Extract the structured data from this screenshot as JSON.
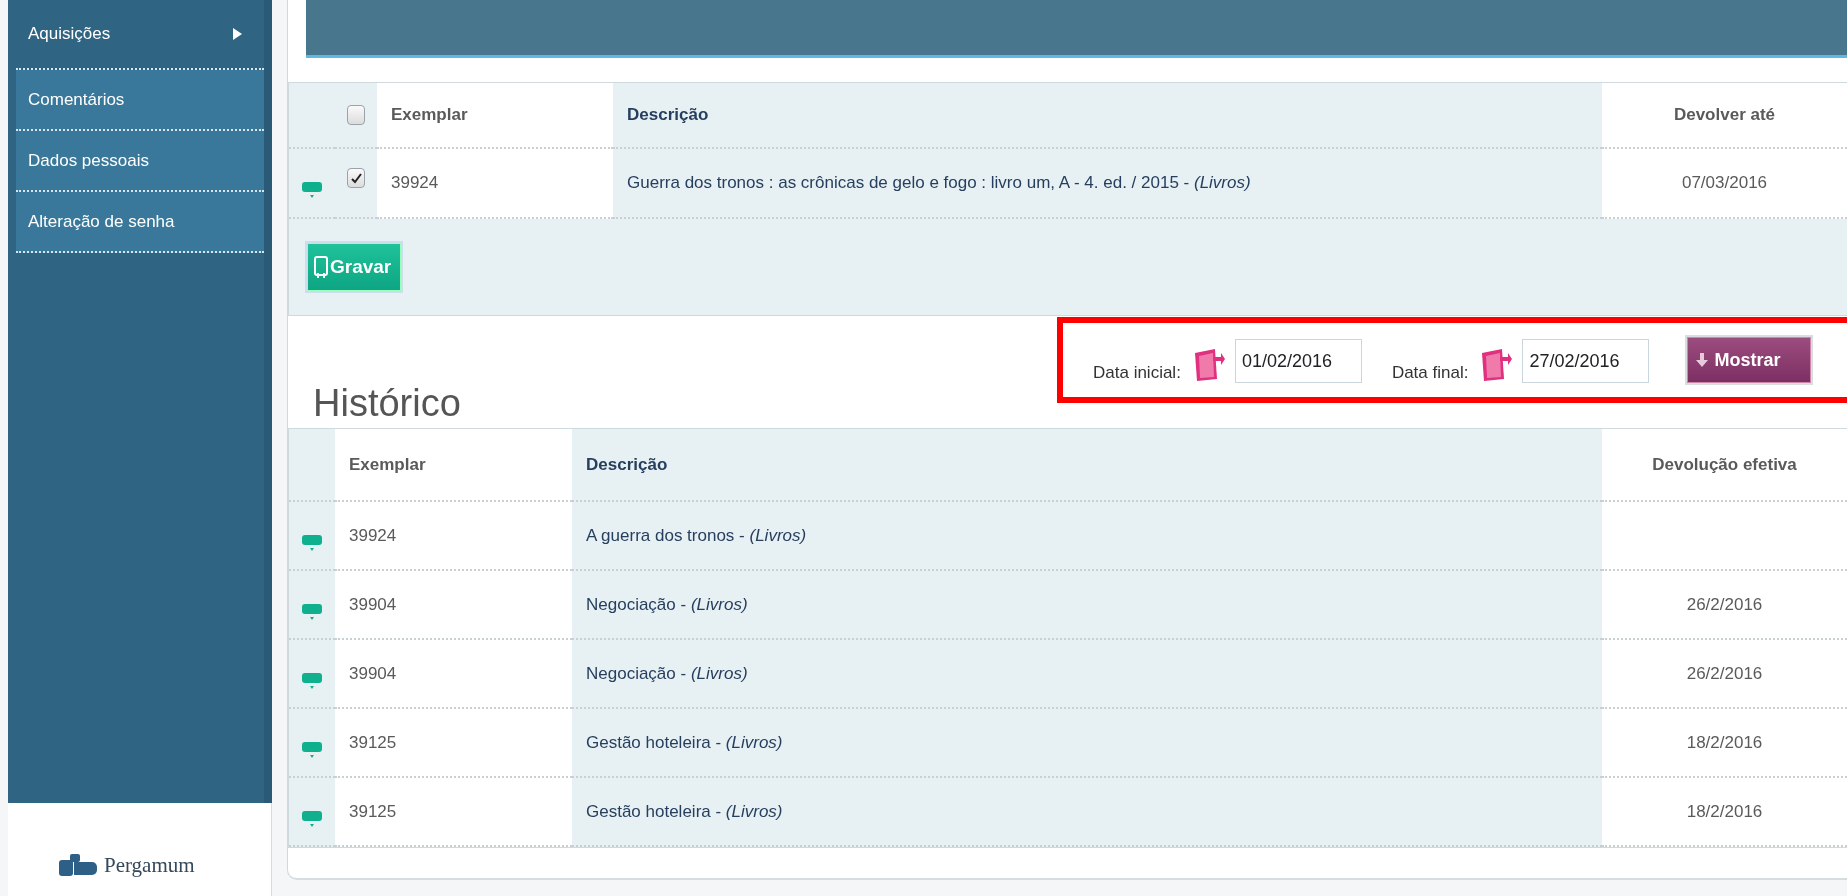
{
  "sidebar": {
    "items": [
      {
        "label": "Aquisições",
        "has_submenu": true,
        "selected": true
      },
      {
        "label": "Comentários",
        "has_submenu": false,
        "selected": false
      },
      {
        "label": "Dados pessoais",
        "has_submenu": false,
        "selected": false
      },
      {
        "label": "Alteração de senha",
        "has_submenu": false,
        "selected": false
      }
    ],
    "logo": "Pergamum"
  },
  "loans": {
    "select_all": {
      "checked": false
    },
    "columns": [
      "Exemplar",
      "Descrição",
      "Devolver até"
    ],
    "rows": [
      {
        "exemplar": "39924",
        "description": "Guerra dos tronos : as crônicas de gelo e fogo : livro um, A - 4. ed. / 2015 - *(Livros)*",
        "due": "07/03/2016",
        "checked": true
      }
    ],
    "save_button": "Gravar"
  },
  "history": {
    "title": "Histórico",
    "filter": {
      "start_label": "Data inicial:",
      "start_value": "01/02/2016",
      "end_label": "Data final:",
      "end_value": "27/02/2016",
      "button": "Mostrar"
    },
    "columns": [
      "Exemplar",
      "Descrição",
      "Devolução efetiva"
    ],
    "rows": [
      {
        "exemplar": "39924",
        "description": "A guerra dos tronos - *(Livros)*"
      },
      {
        "exemplar": "39904",
        "description": "Negociação - *(Livros)*",
        "returned": "26/2/2016"
      },
      {
        "exemplar": "39904",
        "description": "Negociação - *(Livros)*",
        "returned": "26/2/2016"
      },
      {
        "exemplar": "39125",
        "description": "Gestão hoteleira - *(Livros)*",
        "returned": "18/2/2016"
      },
      {
        "exemplar": "39125",
        "description": "Gestão hoteleira - *(Livros)*",
        "returned": "18/2/2016"
      }
    ]
  }
}
